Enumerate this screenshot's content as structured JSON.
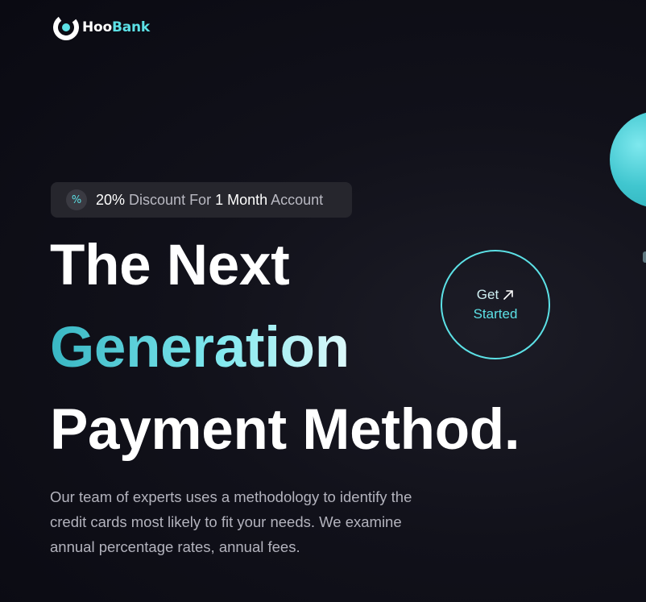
{
  "brand": {
    "name_prefix": "Hoo",
    "name_suffix": "Bank",
    "icon": "hoobank-logo-icon"
  },
  "promo": {
    "icon": "discount-icon",
    "icon_glyph": "%",
    "parts": [
      "20%",
      " Discount For ",
      "1",
      " Month",
      " Account"
    ]
  },
  "hero": {
    "line1": "The Next",
    "line2": "Generation",
    "line3": "Payment Method.",
    "description": "Our team of experts uses a methodology to identify the credit cards most likely to fit your needs. We examine annual percentage rates, annual fees."
  },
  "cta": {
    "line1": "Get",
    "line2": "Started",
    "icon": "arrow-up-right-icon"
  },
  "colors": {
    "accent": "#5ce1e6",
    "background": "#0b0b14",
    "promo_background": "#26262d",
    "text_primary": "#ffffff",
    "text_secondary": "#b3b3bd"
  }
}
